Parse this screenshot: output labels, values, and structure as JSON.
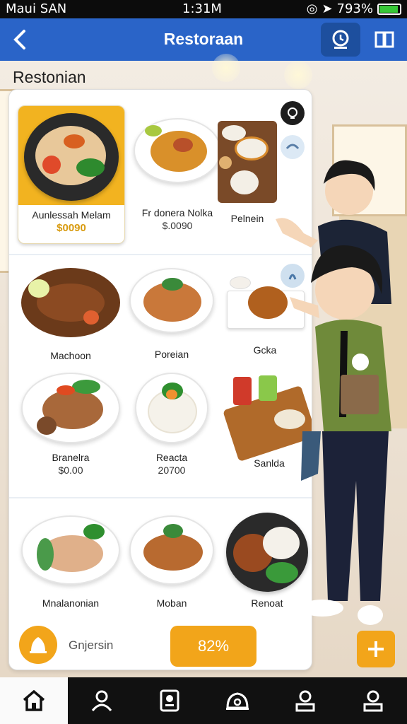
{
  "status_bar": {
    "carrier": "Maui SAN",
    "time": "1:31M",
    "battery": "793%",
    "battery_level": 0.8
  },
  "app_bar": {
    "title": "Restoraan",
    "back_icon": "back-arrow-icon",
    "tip_icon": "waiter-badge-icon",
    "book_icon": "book-icon"
  },
  "section_heading": "Restonian",
  "menu": {
    "dishes": [
      {
        "name": "Aunlessah Melam",
        "price": "$0090"
      },
      {
        "name": "Fr donera Nolka",
        "price": "$.0090"
      },
      {
        "name": "Pelnein",
        "price": ""
      },
      {
        "name": "Machoon",
        "price": ""
      },
      {
        "name": "Poreian",
        "price": ""
      },
      {
        "name": "Gcka",
        "price": ""
      },
      {
        "name": "Branelra",
        "price": "$0.00"
      },
      {
        "name": "Reacta",
        "price": "20700"
      },
      {
        "name": "Sanlda",
        "price": ""
      },
      {
        "name": "Mnalanonian",
        "price": ""
      },
      {
        "name": "Moban",
        "price": ""
      },
      {
        "name": "Renoat",
        "price": ""
      }
    ],
    "footer": {
      "group_label": "Gnjersin",
      "progress": "82%"
    }
  },
  "colors": {
    "accent": "#f2a51a",
    "appbar": "#2a64c8",
    "nav_bg": "#111111"
  },
  "nav_icons": [
    "home-icon",
    "profile-icon",
    "menu-book-icon",
    "bell-cart-icon",
    "account-icon",
    "user-icon"
  ]
}
